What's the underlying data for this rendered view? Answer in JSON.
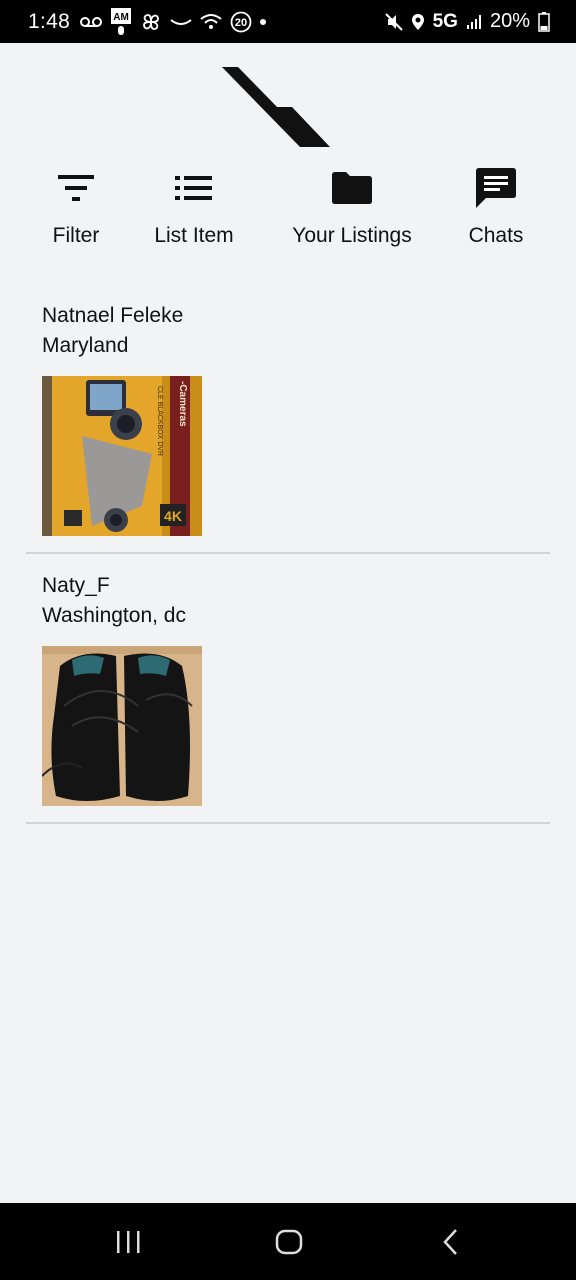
{
  "status_bar": {
    "time": "1:48",
    "network": "5G",
    "battery": "20%",
    "notification_badge": "20",
    "am_badge": "AM"
  },
  "toolbar": {
    "filter_label": "Filter",
    "list_item_label": "List Item",
    "your_listings_label": "Your Listings",
    "chats_label": "Chats"
  },
  "listings": [
    {
      "seller": "Natnael Feleke",
      "location": "Maryland",
      "image": "dashcam-box-photo"
    },
    {
      "seller": "Naty_F",
      "location": "Washington, dc",
      "image": "black-sneakers-photo"
    }
  ],
  "dashcam_box_text": {
    "cameras": "-Cameras",
    "blackbox": "CLE BLACKBOX DVR",
    "resolution": "4K"
  },
  "colors": {
    "logo_blue": "#1e7fc4",
    "logo_black": "#111111",
    "background": "#f2f3f5",
    "divider": "#d3d4d6"
  }
}
